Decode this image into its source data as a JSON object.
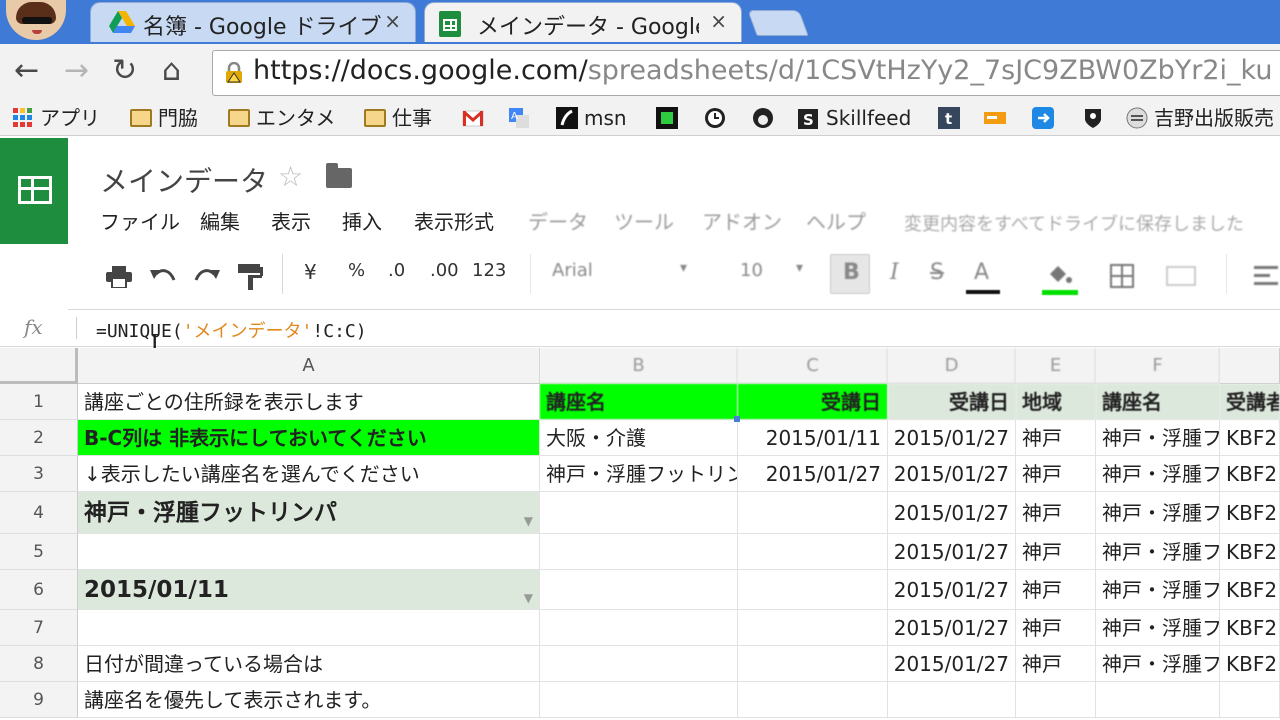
{
  "browser": {
    "tabs": [
      {
        "title": "名簿 - Google ドライブ",
        "close": "×"
      },
      {
        "title": "メインデータ - Google スプレッドシート",
        "close": "×"
      }
    ],
    "url_host": "https://docs.google.com/",
    "url_path": "spreadsheets/d/1CSVtHzYy2_7sJC9ZBW0ZbYr2i_ku",
    "nav": {
      "back": "←",
      "forward": "→",
      "reload": "↻",
      "home": "⌂"
    },
    "bookmarks": [
      {
        "label": "アプリ",
        "icon": "apps-grid-icon"
      },
      {
        "label": "門脇",
        "icon": "folder-icon"
      },
      {
        "label": "エンタメ",
        "icon": "folder-icon"
      },
      {
        "label": "仕事",
        "icon": "folder-icon"
      },
      {
        "label": "",
        "icon": "gmail-icon"
      },
      {
        "label": "",
        "icon": "translate-icon"
      },
      {
        "label": "msn",
        "icon": "msn-icon"
      },
      {
        "label": "",
        "icon": "green-square-icon"
      },
      {
        "label": "",
        "icon": "clock-icon"
      },
      {
        "label": "",
        "icon": "circle-logo-icon"
      },
      {
        "label": "Skillfeed",
        "icon": "skillfeed-icon"
      },
      {
        "label": "",
        "icon": "tumblr-icon"
      },
      {
        "label": "",
        "icon": "orange-card-icon"
      },
      {
        "label": "",
        "icon": "blue-arrow-icon"
      },
      {
        "label": "",
        "icon": "shield-icon"
      },
      {
        "label": "吉野出版販売",
        "icon": "yoshino-icon"
      }
    ]
  },
  "docs": {
    "title": "メインデータ",
    "menu": [
      "ファイル",
      "編集",
      "表示",
      "挿入",
      "表示形式",
      "データ",
      "ツール",
      "アドオン",
      "ヘルプ"
    ],
    "save_status": "変更内容をすべてドライブに保存しました",
    "toolbar": {
      "currency": "¥",
      "percent": "%",
      "dec_decrease": ".0",
      "dec_increase": ".00",
      "more_formats": "123",
      "font": "Arial",
      "font_size": "10",
      "bold": "B",
      "italic": "I",
      "strike": "S",
      "text_color": "A"
    }
  },
  "formula_bar": {
    "fx": "fx",
    "prefix": "=UNIQUE(",
    "string": "'メインデータ'",
    "ref": "!C:C)"
  },
  "grid": {
    "columns": [
      "A",
      "B",
      "C",
      "D",
      "E",
      "F"
    ],
    "rows": [
      "1",
      "2",
      "3",
      "4",
      "5",
      "6",
      "7",
      "8",
      "9"
    ],
    "A": [
      "講座ごとの住所録を表示します",
      "B-C列は 非表示にしておいてください",
      "↓表示したい講座名を選んでください",
      "神戸・浮腫フットリンパ",
      "",
      "2015/01/11",
      "",
      "日付が間違っている場合は",
      "講座名を優先して表示されます。"
    ],
    "B": [
      "講座名",
      "大阪・介護",
      "神戸・浮腫フットリンパ",
      "",
      "",
      "",
      "",
      "",
      ""
    ],
    "C": [
      "受講日",
      "2015/01/11",
      "2015/01/27",
      "",
      "",
      "",
      "",
      "",
      ""
    ],
    "D": [
      "受講日",
      "2015/01/27",
      "2015/01/27",
      "2015/01/27",
      "2015/01/27",
      "2015/01/27",
      "2015/01/27",
      "2015/01/27",
      ""
    ],
    "E": [
      "地域",
      "神戸",
      "神戸",
      "神戸",
      "神戸",
      "神戸",
      "神戸",
      "神戸",
      ""
    ],
    "F": [
      "講座名",
      "神戸・浮腫フ",
      "神戸・浮腫フ",
      "神戸・浮腫フ",
      "神戸・浮腫フ",
      "神戸・浮腫フ",
      "神戸・浮腫フ",
      "神戸・浮腫フ",
      ""
    ],
    "G": [
      "受講者",
      "KBF2",
      "KBF2",
      "KBF2",
      "KBF2",
      "KBF2",
      "KBF2",
      "KBF2",
      ""
    ]
  },
  "colors": {
    "highlight_green": "#00ff00",
    "dropdown_gray": "#dde8dd",
    "sheets_green": "#1e8e3e",
    "chrome_blue": "#3f7bd6"
  }
}
